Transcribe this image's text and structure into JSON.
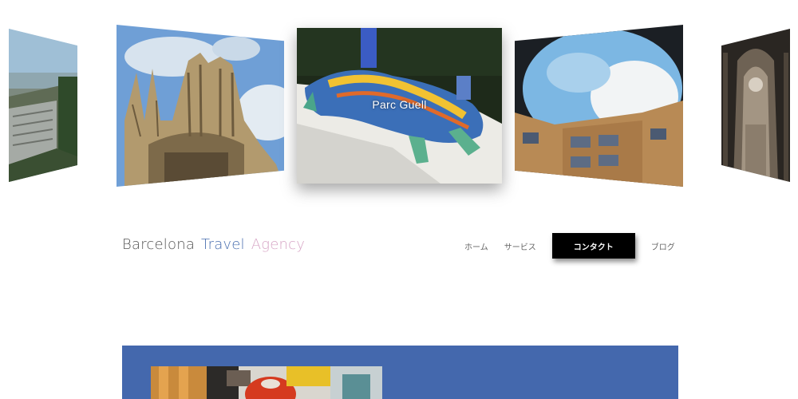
{
  "carousel": {
    "slides": [
      {
        "icon": "stadium-photo",
        "caption": ""
      },
      {
        "icon": "sagrada-familia-photo",
        "caption": ""
      },
      {
        "icon": "parc-guell-dragon-photo",
        "caption": "Parc Guell"
      },
      {
        "icon": "courtyard-sky-photo",
        "caption": ""
      },
      {
        "icon": "cathedral-interior-photo",
        "caption": ""
      }
    ],
    "active_index": 2
  },
  "header": {
    "brand": {
      "word1": "Barcelona",
      "word2": "Travel",
      "word3": "Agency",
      "colors": {
        "word1": "#555555",
        "word2": "#4a6fb0",
        "word3": "#d7a6c6"
      }
    },
    "nav": {
      "home": "ホーム",
      "services": "サービス",
      "contact": "コンタクト",
      "blog": "ブログ",
      "active": "contact"
    }
  },
  "section": {
    "background": "#4468ad",
    "photo_icon": "cafe-interior-photo"
  }
}
